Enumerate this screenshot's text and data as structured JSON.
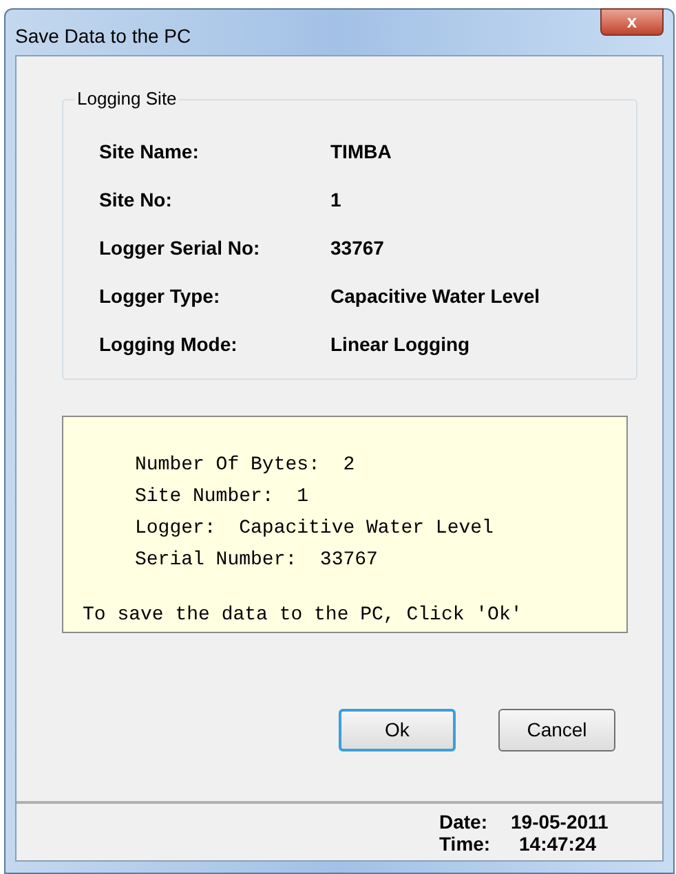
{
  "window": {
    "title": "Save Data to the PC",
    "close": "x"
  },
  "logging_site": {
    "title": "Logging Site",
    "fields": [
      {
        "label": "Site Name:",
        "value": "TIMBA"
      },
      {
        "label": "Site No:",
        "value": "1"
      },
      {
        "label": "Logger Serial No:",
        "value": "33767"
      },
      {
        "label": "Logger Type:",
        "value": "Capacitive Water Level"
      },
      {
        "label": "Logging Mode:",
        "value": "Linear Logging"
      }
    ]
  },
  "summary": {
    "details": [
      "Number Of Bytes:  2",
      "Site Number:  1",
      "Logger:  Capacitive Water Level",
      "Serial Number:  33767"
    ],
    "instruction": "To save the data to the PC, Click 'Ok'"
  },
  "buttons": [
    {
      "label": "Ok",
      "focused": true
    },
    {
      "label": "Cancel",
      "focused": false
    }
  ],
  "status_bar": [
    {
      "label": "Date:",
      "value": "19-05-2011"
    },
    {
      "label": "Time:",
      "value": "14:47:24"
    }
  ]
}
